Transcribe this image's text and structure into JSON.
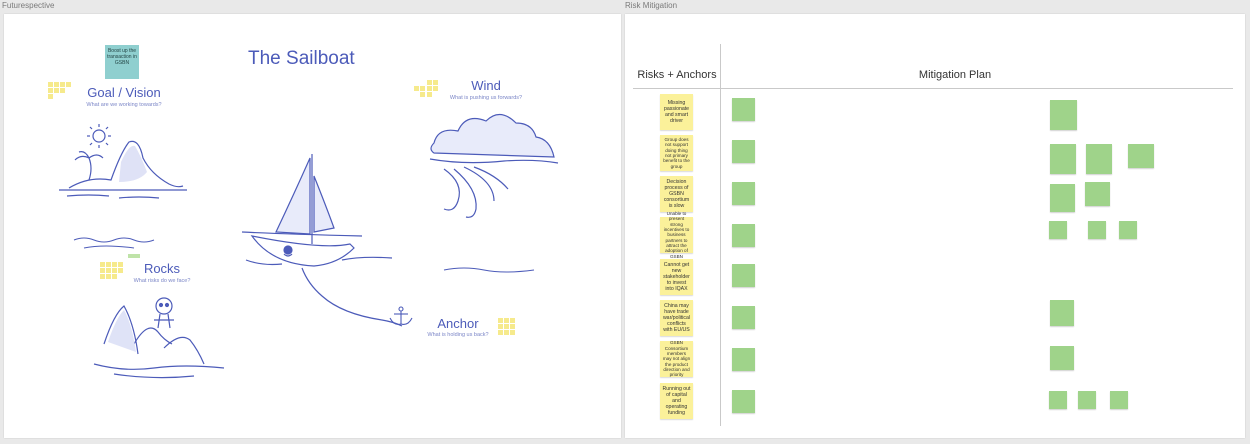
{
  "frames": {
    "left_label": "Futurespective",
    "right_label": "Risk Mitigation"
  },
  "sailboat": {
    "title": "The Sailboat",
    "sticky_note": "Boost up the transaction in GSBN",
    "goal": {
      "title": "Goal / Vision",
      "subtitle": "What are we working towards?"
    },
    "wind": {
      "title": "Wind",
      "subtitle": "What is pushing us forwards?"
    },
    "rocks": {
      "title": "Rocks",
      "subtitle": "What risks do we face?"
    },
    "anchor": {
      "title": "Anchor",
      "subtitle": "What is holding us back?"
    }
  },
  "mitigation": {
    "col_risks": "Risks + Anchors",
    "col_plan": "Mitigation Plan",
    "risks": [
      "Missing passionate and smart driver",
      "Group does not support doing thing not primary benefit to the group",
      "Decision process of GSBN consortium is slow",
      "Unable to present strong incentives to business partners to attract the adoption of GSBN",
      "Cannot get new stakeholder to invest into IQAX",
      "China may have trade war/political conflicts with EU/US",
      "GSBN Consortium members may not align the product direction and priority",
      "Running out of capital and operating funding"
    ]
  }
}
